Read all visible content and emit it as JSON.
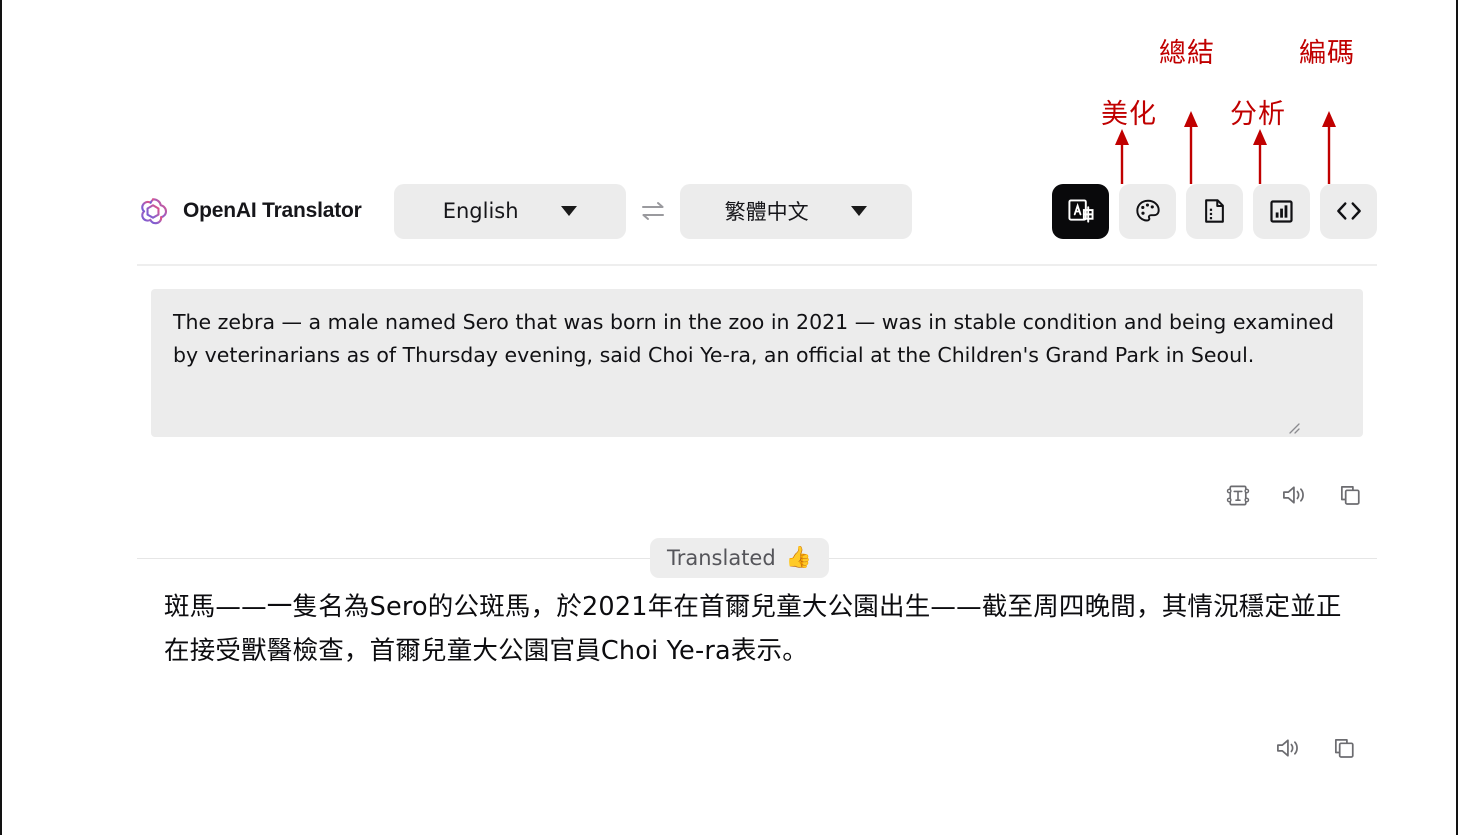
{
  "app": {
    "name": "OpenAI Translator",
    "logo_icon": "openai-logo-icon"
  },
  "languages": {
    "source": "English",
    "target": "繁體中文",
    "swap_icon": "swap-arrows-icon",
    "caret_icon": "chevron-down-icon"
  },
  "toolbar": {
    "buttons": [
      {
        "name": "translate",
        "icon": "translate-icon",
        "label": "Translate",
        "active": true
      },
      {
        "name": "polish",
        "icon": "palette-icon",
        "label": "Polish",
        "active": false
      },
      {
        "name": "summarize",
        "icon": "document-icon",
        "label": "Summarize",
        "active": false
      },
      {
        "name": "analyze",
        "icon": "bar-chart-icon",
        "label": "Analyze",
        "active": false
      },
      {
        "name": "code",
        "icon": "code-brackets-icon",
        "label": "Code",
        "active": false
      }
    ]
  },
  "annotations": {
    "color": "#c00000",
    "items": [
      {
        "text": "美化",
        "target": "polish"
      },
      {
        "text": "總結",
        "target": "summarize"
      },
      {
        "text": "分析",
        "target": "analyze"
      },
      {
        "text": "編碼",
        "target": "code"
      }
    ]
  },
  "source_panel": {
    "text": "The zebra — a male named Sero that was born in the zoo in 2021 — was in stable condition and being examined by veterinarians as of Thursday evening, said Choi Ye-ra, an official at the Children's Grand Park in Seoul.",
    "placeholder": "",
    "actions": [
      {
        "name": "text-format",
        "icon": "text-box-icon"
      },
      {
        "name": "speak",
        "icon": "speaker-icon"
      },
      {
        "name": "copy",
        "icon": "copy-icon"
      }
    ]
  },
  "status": {
    "label": "Translated",
    "emoji": "👍"
  },
  "output_panel": {
    "text": "斑馬——一隻名為Sero的公斑馬，於2021年在首爾兒童大公園出生——截至周四晚間，其情況穩定並正在接受獸醫檢查，首爾兒童大公園官員Choi Ye-ra表示。",
    "actions": [
      {
        "name": "speak",
        "icon": "speaker-icon"
      },
      {
        "name": "copy",
        "icon": "copy-icon"
      }
    ]
  },
  "colors": {
    "accent_black": "#09090b",
    "panel_gray": "#ececec",
    "annotation_red": "#c00000"
  }
}
